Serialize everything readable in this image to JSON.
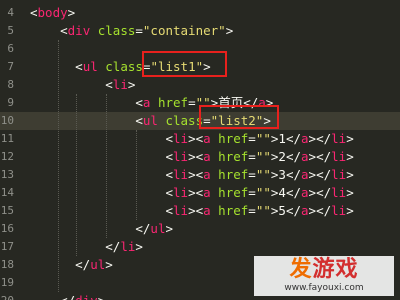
{
  "editor": {
    "theme_colors": {
      "background": "#272822",
      "tag": "#f92672",
      "attribute": "#a6e22e",
      "string": "#e6db74",
      "text": "#f8f8f2",
      "highlight_box": "#e8211d"
    },
    "lines": [
      {
        "num": "4",
        "parts": [
          {
            "t": "<",
            "c": "punc"
          },
          {
            "t": "body",
            "c": "tag"
          },
          {
            "t": ">",
            "c": "punc"
          }
        ]
      },
      {
        "num": "5",
        "parts": [
          {
            "t": "    "
          },
          {
            "t": "<",
            "c": "punc"
          },
          {
            "t": "div",
            "c": "tag"
          },
          {
            "t": " class",
            "c": "attr"
          },
          {
            "t": "=",
            "c": "punc"
          },
          {
            "t": "\"container\"",
            "c": "str"
          },
          {
            "t": ">",
            "c": "punc"
          }
        ]
      },
      {
        "num": "6",
        "parts": []
      },
      {
        "num": "7",
        "parts": [
          {
            "t": "      "
          },
          {
            "t": "<",
            "c": "punc"
          },
          {
            "t": "ul",
            "c": "tag"
          },
          {
            "t": " class",
            "c": "attr"
          },
          {
            "t": "=",
            "c": "punc"
          },
          {
            "t": "\"list1\"",
            "c": "str"
          },
          {
            "t": ">",
            "c": "punc"
          }
        ]
      },
      {
        "num": "8",
        "parts": [
          {
            "t": "          "
          },
          {
            "t": "<",
            "c": "punc"
          },
          {
            "t": "li",
            "c": "tag"
          },
          {
            "t": ">",
            "c": "punc"
          }
        ]
      },
      {
        "num": "9",
        "parts": [
          {
            "t": "              "
          },
          {
            "t": "<",
            "c": "punc"
          },
          {
            "t": "a",
            "c": "tag"
          },
          {
            "t": " href",
            "c": "attr"
          },
          {
            "t": "=",
            "c": "punc"
          },
          {
            "t": "\"\"",
            "c": "str"
          },
          {
            "t": ">",
            "c": "punc"
          },
          {
            "t": "首页",
            "c": "txt"
          },
          {
            "t": "</",
            "c": "punc"
          },
          {
            "t": "a",
            "c": "tag"
          },
          {
            "t": ">",
            "c": "punc"
          }
        ]
      },
      {
        "num": "10",
        "active": true,
        "parts": [
          {
            "t": "              "
          },
          {
            "t": "<",
            "c": "punc"
          },
          {
            "t": "ul",
            "c": "tag"
          },
          {
            "t": " class",
            "c": "attr"
          },
          {
            "t": "=",
            "c": "punc"
          },
          {
            "t": "\"list2\"",
            "c": "str"
          },
          {
            "t": ">",
            "c": "punc"
          }
        ]
      },
      {
        "num": "11",
        "parts": [
          {
            "t": "                  "
          },
          {
            "t": "<",
            "c": "punc"
          },
          {
            "t": "li",
            "c": "tag"
          },
          {
            "t": "><",
            "c": "punc"
          },
          {
            "t": "a",
            "c": "tag"
          },
          {
            "t": " href",
            "c": "attr"
          },
          {
            "t": "=",
            "c": "punc"
          },
          {
            "t": "\"\"",
            "c": "str"
          },
          {
            "t": ">",
            "c": "punc"
          },
          {
            "t": "1",
            "c": "txt"
          },
          {
            "t": "</",
            "c": "punc"
          },
          {
            "t": "a",
            "c": "tag"
          },
          {
            "t": "></",
            "c": "punc"
          },
          {
            "t": "li",
            "c": "tag"
          },
          {
            "t": ">",
            "c": "punc"
          }
        ]
      },
      {
        "num": "12",
        "parts": [
          {
            "t": "                  "
          },
          {
            "t": "<",
            "c": "punc"
          },
          {
            "t": "li",
            "c": "tag"
          },
          {
            "t": "><",
            "c": "punc"
          },
          {
            "t": "a",
            "c": "tag"
          },
          {
            "t": " href",
            "c": "attr"
          },
          {
            "t": "=",
            "c": "punc"
          },
          {
            "t": "\"\"",
            "c": "str"
          },
          {
            "t": ">",
            "c": "punc"
          },
          {
            "t": "2",
            "c": "txt"
          },
          {
            "t": "</",
            "c": "punc"
          },
          {
            "t": "a",
            "c": "tag"
          },
          {
            "t": "></",
            "c": "punc"
          },
          {
            "t": "li",
            "c": "tag"
          },
          {
            "t": ">",
            "c": "punc"
          }
        ]
      },
      {
        "num": "13",
        "parts": [
          {
            "t": "                  "
          },
          {
            "t": "<",
            "c": "punc"
          },
          {
            "t": "li",
            "c": "tag"
          },
          {
            "t": "><",
            "c": "punc"
          },
          {
            "t": "a",
            "c": "tag"
          },
          {
            "t": " href",
            "c": "attr"
          },
          {
            "t": "=",
            "c": "punc"
          },
          {
            "t": "\"\"",
            "c": "str"
          },
          {
            "t": ">",
            "c": "punc"
          },
          {
            "t": "3",
            "c": "txt"
          },
          {
            "t": "</",
            "c": "punc"
          },
          {
            "t": "a",
            "c": "tag"
          },
          {
            "t": "></",
            "c": "punc"
          },
          {
            "t": "li",
            "c": "tag"
          },
          {
            "t": ">",
            "c": "punc"
          }
        ]
      },
      {
        "num": "14",
        "parts": [
          {
            "t": "                  "
          },
          {
            "t": "<",
            "c": "punc"
          },
          {
            "t": "li",
            "c": "tag"
          },
          {
            "t": "><",
            "c": "punc"
          },
          {
            "t": "a",
            "c": "tag"
          },
          {
            "t": " href",
            "c": "attr"
          },
          {
            "t": "=",
            "c": "punc"
          },
          {
            "t": "\"\"",
            "c": "str"
          },
          {
            "t": ">",
            "c": "punc"
          },
          {
            "t": "4",
            "c": "txt"
          },
          {
            "t": "</",
            "c": "punc"
          },
          {
            "t": "a",
            "c": "tag"
          },
          {
            "t": "></",
            "c": "punc"
          },
          {
            "t": "li",
            "c": "tag"
          },
          {
            "t": ">",
            "c": "punc"
          }
        ]
      },
      {
        "num": "15",
        "parts": [
          {
            "t": "                  "
          },
          {
            "t": "<",
            "c": "punc"
          },
          {
            "t": "li",
            "c": "tag"
          },
          {
            "t": "><",
            "c": "punc"
          },
          {
            "t": "a",
            "c": "tag"
          },
          {
            "t": " href",
            "c": "attr"
          },
          {
            "t": "=",
            "c": "punc"
          },
          {
            "t": "\"\"",
            "c": "str"
          },
          {
            "t": ">",
            "c": "punc"
          },
          {
            "t": "5",
            "c": "txt"
          },
          {
            "t": "</",
            "c": "punc"
          },
          {
            "t": "a",
            "c": "tag"
          },
          {
            "t": "></",
            "c": "punc"
          },
          {
            "t": "li",
            "c": "tag"
          },
          {
            "t": ">",
            "c": "punc"
          }
        ]
      },
      {
        "num": "16",
        "parts": [
          {
            "t": "              "
          },
          {
            "t": "</",
            "c": "punc"
          },
          {
            "t": "ul",
            "c": "tag"
          },
          {
            "t": ">",
            "c": "punc"
          }
        ]
      },
      {
        "num": "17",
        "parts": [
          {
            "t": "          "
          },
          {
            "t": "</",
            "c": "punc"
          },
          {
            "t": "li",
            "c": "tag"
          },
          {
            "t": ">",
            "c": "punc"
          }
        ]
      },
      {
        "num": "18",
        "parts": [
          {
            "t": "      "
          },
          {
            "t": "</",
            "c": "punc"
          },
          {
            "t": "ul",
            "c": "tag"
          },
          {
            "t": ">",
            "c": "punc"
          }
        ]
      },
      {
        "num": "19",
        "parts": []
      },
      {
        "num": "20",
        "parts": [
          {
            "t": "    "
          },
          {
            "t": "</",
            "c": "punc"
          },
          {
            "t": "div",
            "c": "tag"
          },
          {
            "t": ">",
            "c": "punc"
          }
        ]
      }
    ]
  },
  "watermark": {
    "logo_first": "发",
    "logo_rest": "游戏",
    "url": "www.fayouxi.com"
  }
}
